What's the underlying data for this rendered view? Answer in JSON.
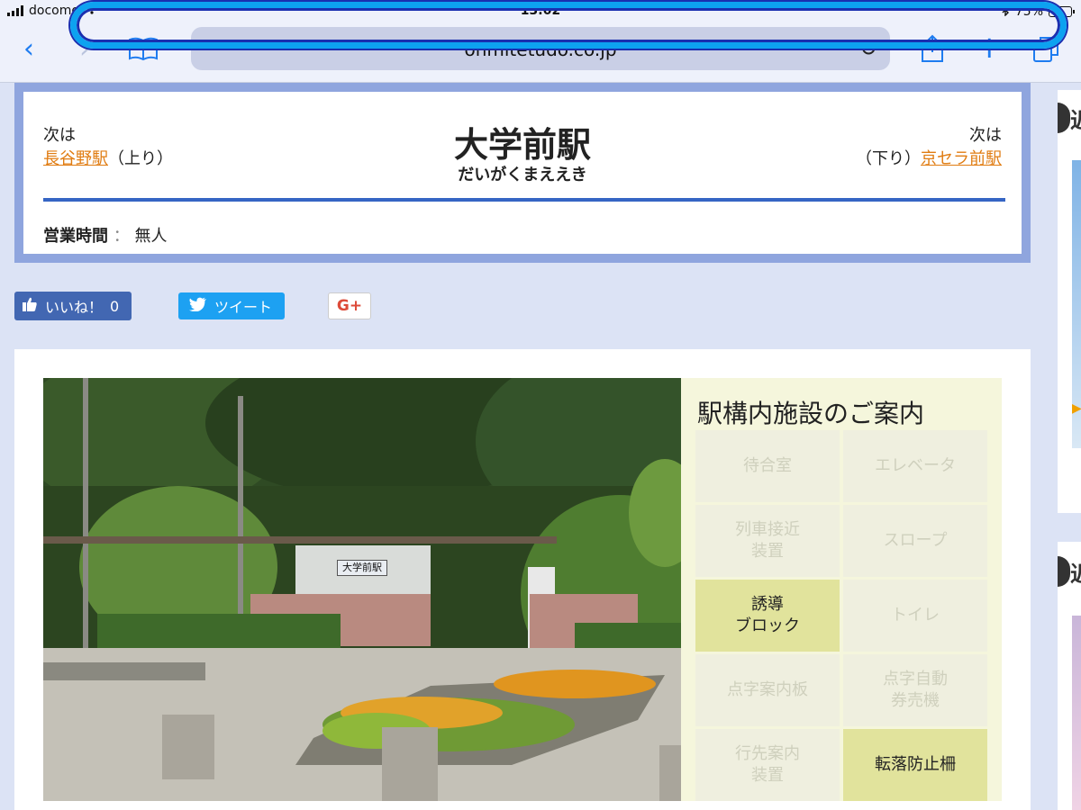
{
  "status_bar": {
    "carrier": "docomo",
    "time": "13:02",
    "battery": "75%",
    "battery_level": 0.75
  },
  "browser": {
    "url": "ohmitetudo.co.jp"
  },
  "station": {
    "prev_label": "次は",
    "prev_station": "長谷野駅",
    "prev_direction": "（上り）",
    "name": "大学前駅",
    "kana": "だいがくまええき",
    "next_label": "次は",
    "next_direction": "（下り）",
    "next_station": "京セラ前駅",
    "hours_label": "営業時間",
    "hours_sep": "：",
    "hours_value": "無人"
  },
  "social": {
    "like_label": "いいね！",
    "like_count": "0",
    "tweet_label": "ツイート",
    "gplus_label": "G+"
  },
  "photo": {
    "sign_text": "大学前駅"
  },
  "facilities": {
    "title": "駅構内施設のご案内",
    "items": [
      {
        "label": "待合室",
        "available": false
      },
      {
        "label": "エレベータ",
        "available": false
      },
      {
        "label": "列車接近\n装置",
        "available": false
      },
      {
        "label": "スロープ",
        "available": false
      },
      {
        "label": "誘導\nブロック",
        "available": true
      },
      {
        "label": "トイレ",
        "available": false
      },
      {
        "label": "点字案内板",
        "available": false
      },
      {
        "label": "点字自動\n券売機",
        "available": false
      },
      {
        "label": "行先案内\n装置",
        "available": false
      },
      {
        "label": "転落防止柵",
        "available": true
      }
    ]
  },
  "sidebar": {
    "char1": "近",
    "char2": "近"
  },
  "colors": {
    "accent_blue": "#3565c4",
    "link_orange": "#e07c12",
    "facility_on": "#e1e39c",
    "facility_off": "#efefdf",
    "highlight": "#0da2f0"
  }
}
